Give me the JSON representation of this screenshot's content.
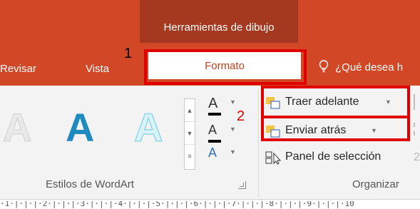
{
  "ribbon": {
    "contextual_header": "Herramientas de dibujo",
    "tabs": [
      {
        "label": "Revisar"
      },
      {
        "label": "Vista"
      },
      {
        "label": "Formato"
      }
    ],
    "tell_me": "¿Qué desea h",
    "colors": {
      "accent": "#d24726",
      "contextual": "#a5391f",
      "highlight": "#e00000"
    }
  },
  "annotations": {
    "one": "1",
    "two": "2"
  },
  "wordart": {
    "sample_letter": "A",
    "group_label": "Estilos de WordArt",
    "text_fill_glyph": "A",
    "text_outline_glyph": "A",
    "text_effects_glyph": "A"
  },
  "arrange": {
    "bring_forward": "Traer adelante",
    "send_backward": "Enviar atrás",
    "selection_pane": "Panel de selección",
    "group_label": "Organizar",
    "cut_off_digit": "2"
  },
  "ruler": {
    "text": "·1·|·|·|·2·|·|·|·3·|·|·|·4·|·|·|·5·|·|·|·6·|·|·|·7·|·|·|·8·|·|·|·9·|·|·|·10"
  }
}
